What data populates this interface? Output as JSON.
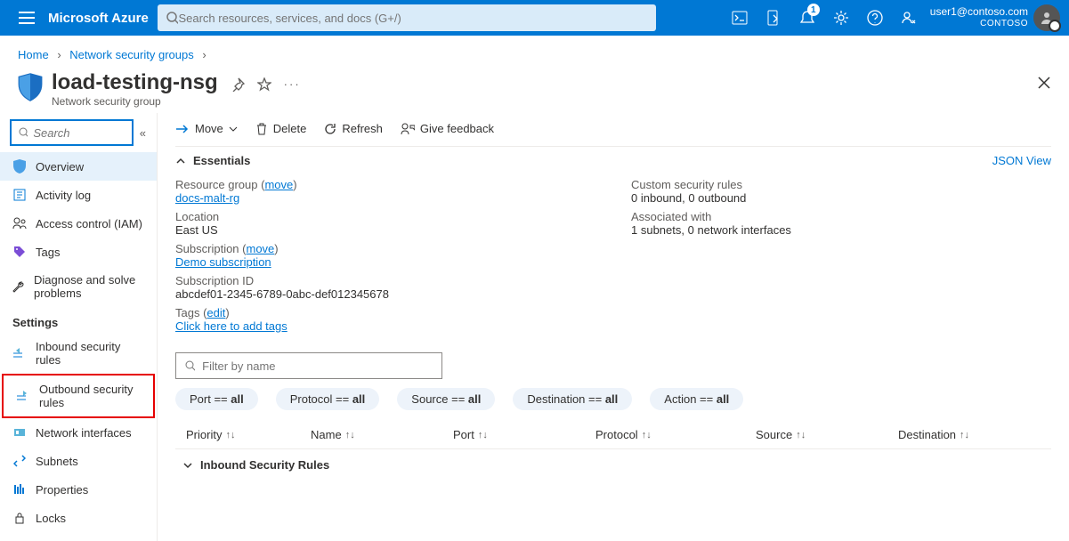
{
  "topbar": {
    "brand": "Microsoft Azure",
    "search_placeholder": "Search resources, services, and docs (G+/)",
    "notification_count": "1",
    "user_email": "user1@contoso.com",
    "tenant": "CONTOSO"
  },
  "breadcrumb": {
    "items": [
      "Home",
      "Network security groups"
    ]
  },
  "header": {
    "title": "load-testing-nsg",
    "subtitle": "Network security group"
  },
  "sidebar": {
    "search_placeholder": "Search",
    "items": [
      {
        "label": "Overview",
        "icon": "shield",
        "selected": true
      },
      {
        "label": "Activity log",
        "icon": "log"
      },
      {
        "label": "Access control (IAM)",
        "icon": "iam"
      },
      {
        "label": "Tags",
        "icon": "tag"
      },
      {
        "label": "Diagnose and solve problems",
        "icon": "wrench"
      }
    ],
    "settings_label": "Settings",
    "settings": [
      {
        "label": "Inbound security rules",
        "icon": "inbound"
      },
      {
        "label": "Outbound security rules",
        "icon": "outbound",
        "highlight": true
      },
      {
        "label": "Network interfaces",
        "icon": "nic"
      },
      {
        "label": "Subnets",
        "icon": "subnet"
      },
      {
        "label": "Properties",
        "icon": "props"
      },
      {
        "label": "Locks",
        "icon": "lock"
      }
    ]
  },
  "commands": {
    "move": "Move",
    "delete": "Delete",
    "refresh": "Refresh",
    "feedback": "Give feedback"
  },
  "essentials": {
    "header": "Essentials",
    "json_view": "JSON View",
    "left": [
      {
        "label": "Resource group",
        "link_action": "move",
        "value": "docs-malt-rg",
        "is_link": true
      },
      {
        "label": "Location",
        "value": "East US"
      },
      {
        "label": "Subscription",
        "link_action": "move",
        "value": "Demo subscription",
        "is_link": true
      },
      {
        "label": "Subscription ID",
        "value": "abcdef01-2345-6789-0abc-def012345678"
      },
      {
        "label": "Tags",
        "link_action": "edit",
        "value": "Click here to add tags",
        "is_link": true
      }
    ],
    "right": [
      {
        "label": "Custom security rules",
        "value": "0 inbound, 0 outbound"
      },
      {
        "label": "Associated with",
        "value": "1 subnets, 0 network interfaces"
      }
    ]
  },
  "filter": {
    "placeholder": "Filter by name",
    "pills": [
      {
        "prefix": "Port == ",
        "value": "all"
      },
      {
        "prefix": "Protocol == ",
        "value": "all"
      },
      {
        "prefix": "Source == ",
        "value": "all"
      },
      {
        "prefix": "Destination == ",
        "value": "all"
      },
      {
        "prefix": "Action == ",
        "value": "all"
      }
    ]
  },
  "table": {
    "columns": [
      "Priority",
      "Name",
      "Port",
      "Protocol",
      "Source",
      "Destination"
    ],
    "section": "Inbound Security Rules"
  }
}
